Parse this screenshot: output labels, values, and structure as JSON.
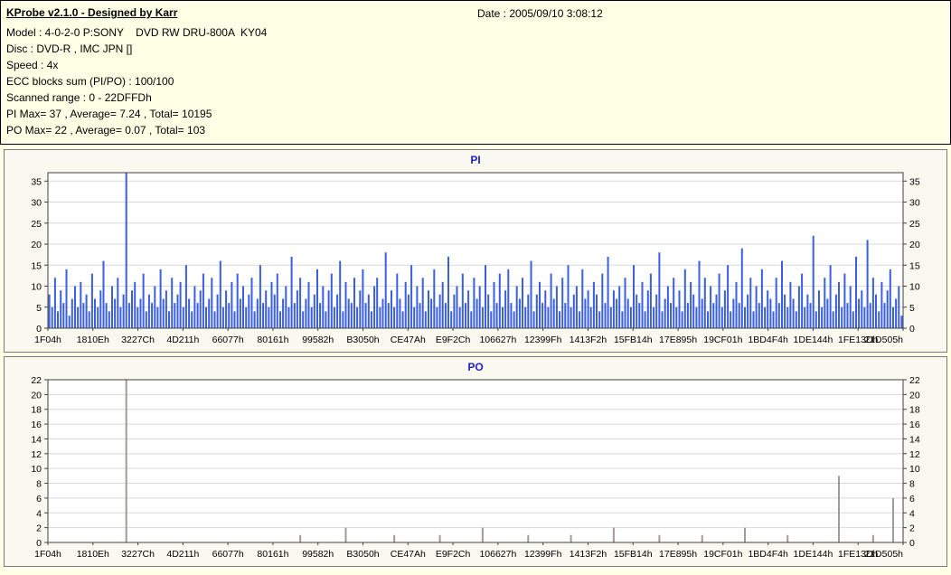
{
  "header": {
    "title": "KProbe v2.1.0 - Designed by Karr",
    "date": "Date : 2005/09/10 3:08:12",
    "info_lines": [
      "Model : 4-0-2-0 P:SONY    DVD RW DRU-800A  KY04",
      "Disc : DVD-R , IMC JPN []",
      "Speed : 4x",
      "ECC blocks sum (PI/PO) : 100/100",
      "Scanned range : 0 - 22DFFDh",
      "PI Max= 37 , Average= 7.24 , Total= 10195",
      "PO Max= 22 , Average= 0.07 , Total= 103"
    ]
  },
  "chart_data": [
    {
      "type": "bar",
      "title": "PI",
      "title_color": "#2121c8",
      "bar_color": "#3a5fe0",
      "ylim": [
        0,
        37
      ],
      "yticks": [
        0,
        5,
        10,
        15,
        20,
        25,
        30,
        35
      ],
      "grid": true,
      "legend": "none",
      "x_labels": [
        "1F04h",
        "1810Eh",
        "3227Ch",
        "4D211h",
        "66077h",
        "80161h",
        "99582h",
        "B3050h",
        "CE47Ah",
        "E9F2Ch",
        "106627h",
        "12399Fh",
        "1413F2h",
        "15FB14h",
        "17E895h",
        "19CF01h",
        "1BD4F4h",
        "1DE144h",
        "1FE13Dh",
        "21D505h"
      ],
      "stats": {
        "max": 37,
        "average": 7.24,
        "total": 10195
      },
      "values": [
        8,
        5,
        12,
        4,
        9,
        6,
        14,
        3,
        7,
        10,
        5,
        11,
        6,
        8,
        4,
        13,
        7,
        5,
        9,
        16,
        6,
        4,
        10,
        7,
        12,
        5,
        8,
        37,
        6,
        9,
        11,
        5,
        7,
        13,
        4,
        8,
        6,
        10,
        5,
        14,
        7,
        9,
        4,
        12,
        6,
        8,
        11,
        5,
        15,
        7,
        4,
        10,
        6,
        9,
        13,
        5,
        7,
        12,
        4,
        8,
        16,
        5,
        9,
        6,
        11,
        4,
        13,
        7,
        10,
        5,
        8,
        12,
        4,
        7,
        15,
        6,
        9,
        5,
        11,
        8,
        13,
        4,
        7,
        10,
        5,
        17,
        6,
        9,
        12,
        4,
        7,
        11,
        5,
        8,
        14,
        6,
        10,
        4,
        9,
        13,
        5,
        8,
        16,
        4,
        11,
        7,
        6,
        12,
        5,
        9,
        14,
        6,
        8,
        4,
        10,
        12,
        5,
        7,
        18,
        6,
        9,
        5,
        13,
        7,
        4,
        11,
        8,
        15,
        5,
        10,
        6,
        12,
        4,
        9,
        7,
        14,
        5,
        8,
        11,
        6,
        17,
        4,
        8,
        10,
        5,
        13,
        6,
        9,
        4,
        12,
        7,
        10,
        5,
        15,
        8,
        4,
        11,
        6,
        13,
        5,
        9,
        14,
        6,
        4,
        10,
        7,
        12,
        5,
        8,
        16,
        4,
        8,
        11,
        6,
        9,
        5,
        13,
        7,
        10,
        4,
        12,
        6,
        15,
        5,
        8,
        10,
        4,
        14,
        7,
        9,
        5,
        11,
        8,
        4,
        13,
        6,
        17,
        5,
        9,
        7,
        10,
        4,
        12,
        7,
        5,
        15,
        8,
        6,
        11,
        4,
        9,
        13,
        5,
        8,
        18,
        4,
        7,
        10,
        6,
        12,
        5,
        9,
        4,
        14,
        6,
        11,
        8,
        5,
        16,
        7,
        12,
        4,
        10,
        6,
        8,
        13,
        5,
        9,
        15,
        4,
        7,
        11,
        6,
        19,
        5,
        8,
        12,
        4,
        10,
        6,
        14,
        5,
        9,
        7,
        4,
        12,
        6,
        16,
        8,
        5,
        11,
        7,
        4,
        10,
        13,
        5,
        8,
        6,
        22,
        4,
        9,
        5,
        12,
        7,
        15,
        4,
        8,
        11,
        5,
        13,
        6,
        10,
        4,
        17,
        7,
        9,
        5,
        21,
        6,
        12,
        8,
        4,
        11,
        6,
        9,
        14,
        5,
        7,
        10,
        3
      ]
    },
    {
      "type": "bar",
      "title": "PO",
      "title_color": "#2121c8",
      "bar_color": "#a59898",
      "ylim": [
        0,
        22
      ],
      "yticks": [
        0,
        2,
        4,
        6,
        8,
        10,
        12,
        14,
        16,
        18,
        20,
        22
      ],
      "grid": true,
      "legend": "none",
      "x_labels": [
        "1F04h",
        "1810Eh",
        "3227Ch",
        "4D211h",
        "66077h",
        "80161h",
        "99582h",
        "B3050h",
        "CE47Ah",
        "E9F2Ch",
        "106627h",
        "12399Fh",
        "1413F2h",
        "15FB14h",
        "17E895h",
        "19CF01h",
        "1BD4F4h",
        "1DE144h",
        "1FE13Dh",
        "21D505h"
      ],
      "stats": {
        "max": 22,
        "average": 0.07,
        "total": 103
      },
      "values_sparse": {
        "length": 300,
        "points": [
          [
            27,
            22
          ],
          [
            88,
            1
          ],
          [
            104,
            2
          ],
          [
            121,
            1
          ],
          [
            137,
            1
          ],
          [
            152,
            2
          ],
          [
            168,
            1
          ],
          [
            183,
            1
          ],
          [
            198,
            2
          ],
          [
            214,
            1
          ],
          [
            229,
            1
          ],
          [
            244,
            2
          ],
          [
            259,
            1
          ],
          [
            277,
            9
          ],
          [
            289,
            1
          ],
          [
            296,
            6
          ]
        ]
      }
    }
  ]
}
